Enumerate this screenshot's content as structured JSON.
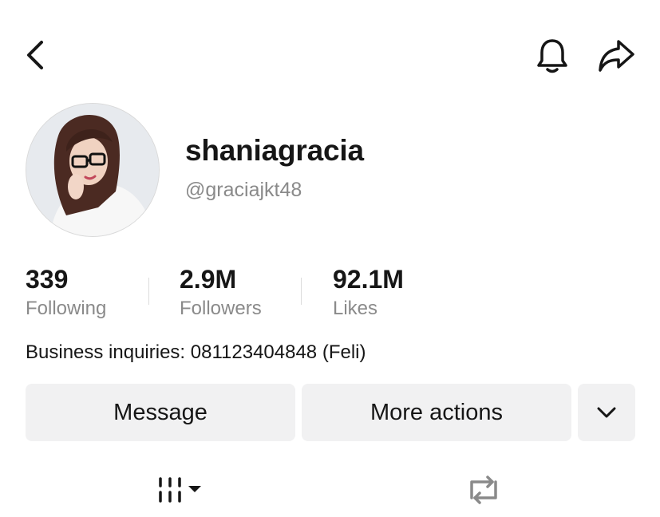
{
  "header": {
    "back_icon": "chevron-left-icon",
    "bell_icon": "bell-icon",
    "share_icon": "share-arrow-icon"
  },
  "profile": {
    "display_name": "shaniagracia",
    "handle": "@graciajkt48",
    "avatar_alt": "profile photo"
  },
  "stats": [
    {
      "value": "339",
      "label": "Following"
    },
    {
      "value": "2.9M",
      "label": "Followers"
    },
    {
      "value": "92.1M",
      "label": "Likes"
    }
  ],
  "bio": "Business inquiries: 081123404848 (Feli)",
  "actions": {
    "message_label": "Message",
    "more_actions_label": "More actions",
    "dropdown_icon": "chevron-down-icon"
  },
  "tabs": {
    "videos_icon": "grid-lines-icon",
    "reposts_icon": "repost-icon"
  },
  "colors": {
    "text_primary": "#161616",
    "text_secondary": "#8a8a8a",
    "button_bg": "#f1f1f2"
  }
}
